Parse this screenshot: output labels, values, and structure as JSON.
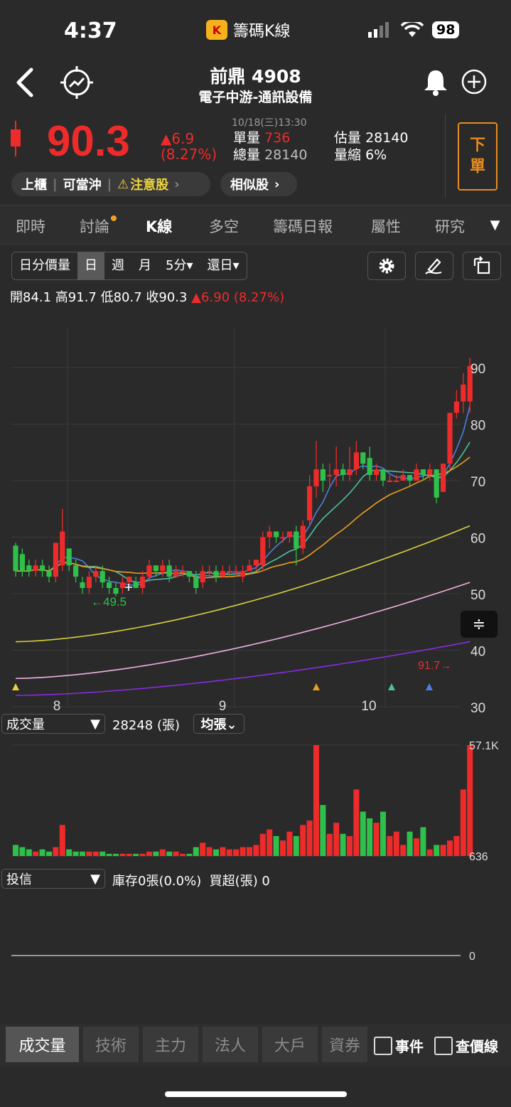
{
  "status": {
    "time": "4:37",
    "app_name": "籌碼K線",
    "logo_text": "K",
    "battery": "98"
  },
  "header": {
    "title": "前鼎 4908",
    "subtitle": "電子中游-通訊設備"
  },
  "quote": {
    "price": "90.3",
    "change": "▲6.9",
    "change_pct": "(8.27%)",
    "datetime": "10/18(三)13:30",
    "unit_vol_label": "單量",
    "unit_vol": "736",
    "est_vol_label": "估量",
    "est_vol": "28140",
    "total_vol_label": "總量",
    "total_vol": "28140",
    "vol_shrink_label": "量縮",
    "vol_shrink": "6%",
    "sell_1": "下",
    "sell_2": "單",
    "tags": [
      "上櫃",
      "可當沖",
      "注意股"
    ],
    "similar": "相似股"
  },
  "tabs": [
    "即時",
    "討論",
    "K線",
    "多空",
    "籌碼日報",
    "屬性",
    "研究"
  ],
  "periods": [
    "日分價量",
    "日",
    "週",
    "月",
    "5分▾",
    "還日▾"
  ],
  "ohlc": {
    "text": "開84.1 高91.7 低80.7 收90.3",
    "chg": "▲6.90 (8.27%)"
  },
  "chart_data": {
    "type": "candlestick",
    "y_ticks": [
      "90",
      "80",
      "70",
      "60",
      "50",
      "40",
      "30"
    ],
    "x_ticks": [
      "8",
      "9",
      "10"
    ],
    "high_label": "91.7→",
    "low_label": "←49.5",
    "volume_selector": "成交量",
    "volume_value": "28248 (張)",
    "volume_mode": "均張⌄",
    "volume_axis": [
      "57.1K",
      "636"
    ],
    "inst_selector": "投信",
    "inst_info": "庫存0張(0.0%)  買超(張) 0",
    "inst_axis": "0",
    "candles": [
      [
        58.5,
        54,
        59,
        53
      ],
      [
        57,
        54,
        58,
        53
      ],
      [
        55,
        54,
        56,
        53
      ],
      [
        54,
        55,
        56,
        53
      ],
      [
        55,
        54,
        56,
        53
      ],
      [
        54,
        53,
        55,
        52
      ],
      [
        53,
        59,
        59,
        52
      ],
      [
        55,
        61,
        65,
        54
      ],
      [
        58,
        55,
        58,
        54
      ],
      [
        55,
        53,
        56,
        52
      ],
      [
        52,
        51,
        53,
        50
      ],
      [
        51,
        53,
        54,
        50
      ],
      [
        53,
        54,
        55,
        52
      ],
      [
        54,
        52,
        55,
        51
      ],
      [
        52,
        51,
        53,
        50
      ],
      [
        51,
        50,
        52,
        49.5
      ],
      [
        51,
        52,
        53,
        50
      ],
      [
        52,
        53,
        53,
        51
      ],
      [
        52,
        51,
        53,
        51
      ],
      [
        51,
        53,
        54,
        50
      ],
      [
        53,
        55,
        56,
        52
      ],
      [
        55,
        54,
        55,
        53
      ],
      [
        54,
        55,
        56,
        53
      ],
      [
        55,
        53,
        56,
        52
      ],
      [
        53,
        54,
        55,
        53
      ],
      [
        54,
        54,
        55,
        53
      ],
      [
        54,
        53,
        54,
        52
      ],
      [
        53,
        51,
        54,
        50
      ],
      [
        52,
        54,
        55,
        51
      ],
      [
        54,
        54,
        55,
        53
      ],
      [
        54,
        53,
        55,
        52
      ],
      [
        53,
        54,
        55,
        53
      ],
      [
        54,
        54,
        55,
        53
      ],
      [
        54,
        54,
        55,
        53
      ],
      [
        53,
        54,
        55,
        52
      ],
      [
        54,
        55,
        56,
        54
      ],
      [
        55,
        56,
        56,
        54
      ],
      [
        55,
        60,
        61,
        54
      ],
      [
        60,
        61,
        62,
        58
      ],
      [
        61,
        60,
        61,
        59
      ],
      [
        60,
        60,
        61,
        59
      ],
      [
        60,
        61,
        61,
        59
      ],
      [
        61,
        58,
        62,
        55
      ],
      [
        58,
        62,
        63,
        57
      ],
      [
        63,
        69,
        71,
        62
      ],
      [
        69,
        72,
        77,
        67
      ],
      [
        72,
        70,
        73,
        68
      ],
      [
        71,
        71,
        73,
        69
      ],
      [
        71,
        72,
        76,
        69
      ],
      [
        72,
        71,
        73,
        70
      ],
      [
        71,
        72,
        76,
        70
      ],
      [
        72,
        75,
        77,
        71
      ],
      [
        75,
        73,
        75,
        72
      ],
      [
        74,
        71,
        76,
        70
      ],
      [
        71,
        72,
        73,
        70
      ],
      [
        72,
        70,
        72,
        69
      ],
      [
        70,
        70,
        71,
        70
      ],
      [
        70,
        70,
        71,
        70
      ],
      [
        70,
        71,
        72,
        70
      ],
      [
        71,
        70,
        71,
        69
      ],
      [
        70,
        72,
        73,
        70
      ],
      [
        72,
        71,
        72,
        70
      ],
      [
        71,
        72,
        73,
        70
      ],
      [
        72,
        67,
        72,
        66
      ],
      [
        68,
        73,
        73,
        68
      ],
      [
        73,
        82,
        82,
        72
      ],
      [
        82,
        84,
        86,
        81
      ],
      [
        84,
        87,
        89,
        82
      ],
      [
        84,
        90.3,
        91.7,
        82
      ]
    ],
    "volumes": [
      5,
      4,
      3,
      2,
      3,
      2,
      4,
      14,
      3,
      2,
      2,
      2,
      2,
      2,
      1,
      1,
      1,
      1,
      1,
      1,
      2,
      2,
      3,
      2,
      2,
      1,
      1,
      4,
      6,
      4,
      3,
      4,
      3,
      3,
      4,
      4,
      5,
      10,
      12,
      9,
      7,
      11,
      9,
      14,
      16,
      50,
      23,
      10,
      15,
      10,
      9,
      30,
      20,
      17,
      15,
      20,
      9,
      11,
      5,
      11,
      8,
      13,
      3,
      5,
      5,
      7,
      9,
      30,
      50,
      38
    ]
  }
}
